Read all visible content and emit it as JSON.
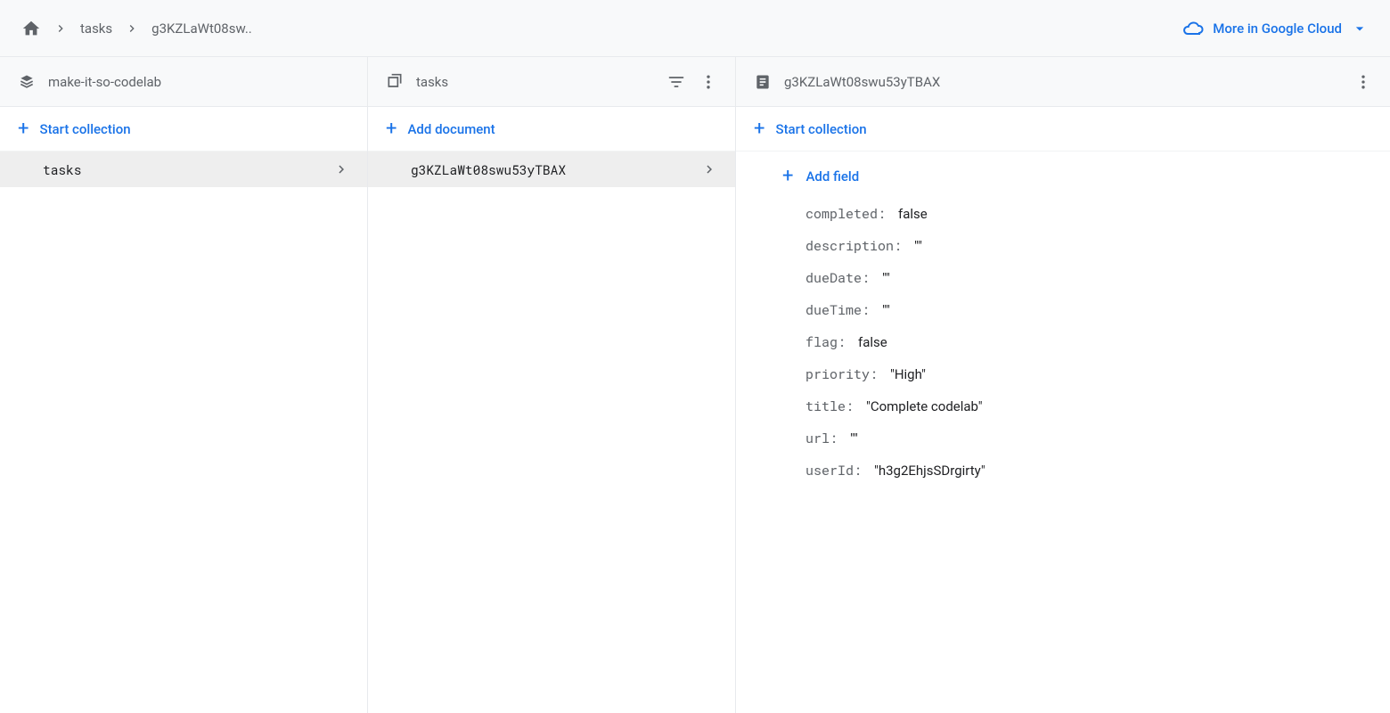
{
  "breadcrumb": {
    "items": [
      "tasks",
      "g3KZLaWt08sw.."
    ]
  },
  "cloud_link": "More in Google Cloud",
  "panel1": {
    "title": "make-it-so-codelab",
    "action": "Start collection",
    "items": [
      {
        "label": "tasks"
      }
    ]
  },
  "panel2": {
    "title": "tasks",
    "action": "Add document",
    "items": [
      {
        "label": "g3KZLaWt08swu53yTBAX"
      }
    ]
  },
  "panel3": {
    "title": "g3KZLaWt08swu53yTBAX",
    "action": "Start collection",
    "add_field": "Add field",
    "fields": [
      {
        "key": "completed",
        "val": "false"
      },
      {
        "key": "description",
        "val": "\"\""
      },
      {
        "key": "dueDate",
        "val": "\"\""
      },
      {
        "key": "dueTime",
        "val": "\"\""
      },
      {
        "key": "flag",
        "val": "false"
      },
      {
        "key": "priority",
        "val": "\"High\""
      },
      {
        "key": "title",
        "val": "\"Complete codelab\""
      },
      {
        "key": "url",
        "val": "\"\""
      },
      {
        "key": "userId",
        "val": "\"h3g2EhjsSDrgirty\""
      }
    ]
  }
}
